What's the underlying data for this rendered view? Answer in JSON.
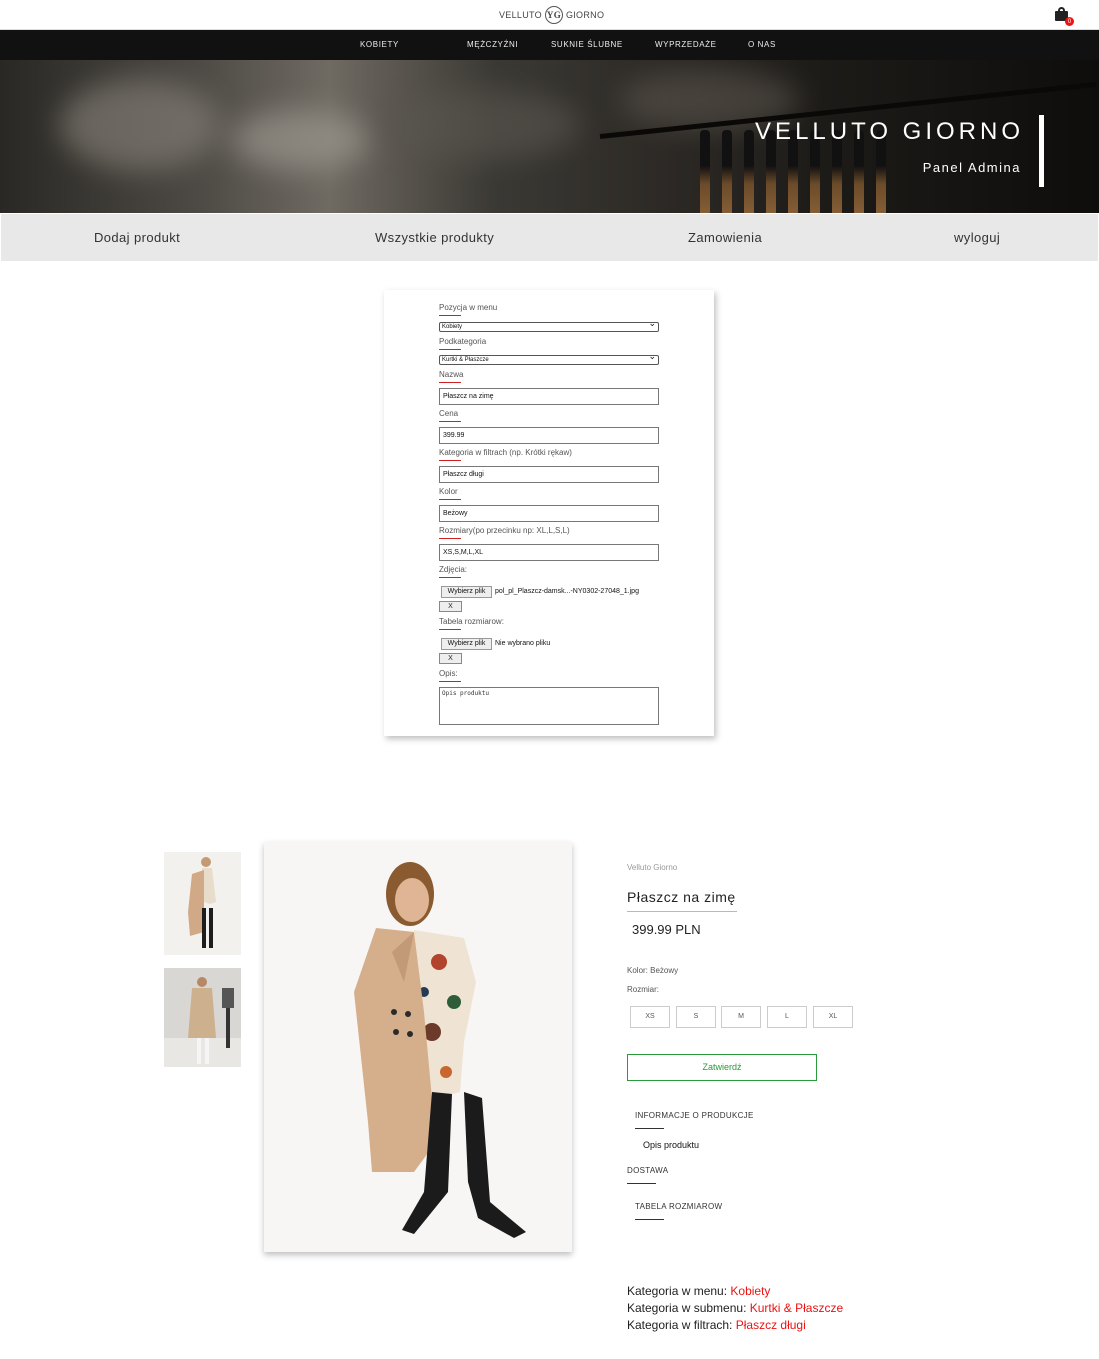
{
  "header": {
    "logo_left": "VELLUTO",
    "logo_mark": "YG",
    "logo_right": "GIORNO",
    "cart_count": "0"
  },
  "nav": {
    "items": [
      "KOBIETY",
      "MĘŻCZYŹNI",
      "SUKNIE ŚLUBNE",
      "WYPRZEDAŻE",
      "O NAS"
    ]
  },
  "hero": {
    "title": "VELLUTO GIORNO",
    "subtitle": "Panel Admina"
  },
  "admin_menu": {
    "items": [
      "Dodaj produkt",
      "Wszystkie produkty",
      "Zamowienia",
      "wyloguj"
    ]
  },
  "form": {
    "menu_position_label": "Pozycja w menu",
    "menu_position_value": "Kobiety",
    "subcategory_label": "Podkategoria",
    "subcategory_value": "Kurtki & Płaszcze",
    "name_label": "Nazwa",
    "name_value": "Płaszcz na zimę",
    "price_label": "Cena",
    "price_value": "399.99",
    "filter_category_label": "Kategoria w filtrach (np. Krótki rękaw)",
    "filter_category_value": "Płaszcz długi",
    "color_label": "Kolor",
    "color_value": "Beżowy",
    "sizes_label": "Rozmiary(po przecinku np: XL,L,S,L)",
    "sizes_value": "XS,S,M,L,XL",
    "photos_label": "Zdjęcia:",
    "choose_file_label": "Wybierz plik",
    "photos_file": "pol_pl_Plaszcz-damsk...-NY0302-27048_1.jpg",
    "remove_label": "X",
    "size_table_label": "Tabela rozmiarow:",
    "size_table_file": "Nie wybrano pliku",
    "description_label": "Opis:",
    "description_value": "Opis produktu"
  },
  "preview": {
    "brand": "Velluto Giorno",
    "name": "Płaszcz na zimę",
    "price": "399.99 PLN",
    "color_text": "Kolor: Beżowy",
    "size_label": "Rozmiar:",
    "sizes": [
      "XS",
      "S",
      "M",
      "L",
      "XL"
    ],
    "submit_label": "Zatwierdź",
    "info_label": "INFORMACJE O PRODUKCJE",
    "description": "Opis produktu",
    "delivery_label": "DOSTAWA",
    "size_table_label": "TABELA ROZMIAROW",
    "menu_category_label": "Kategoria w menu: ",
    "menu_category_value": "Kobiety",
    "submenu_category_label": "Kategoria w submenu: ",
    "submenu_category_value": "Kurtki & Płaszcze",
    "filter_category_label": "Kategoria w filtrach: ",
    "filter_category_value": "Płaszcz długi"
  },
  "colors": {
    "accent_red": "#e11111",
    "confirm_green": "#2a9a3a",
    "nav_bg": "#111111"
  }
}
